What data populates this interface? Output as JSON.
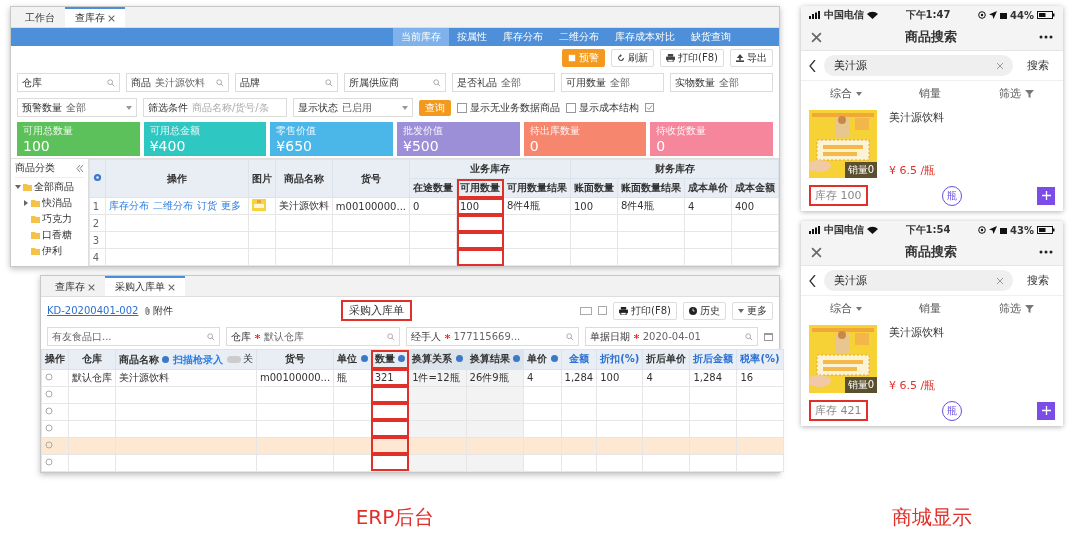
{
  "erp_inventory": {
    "tabs": [
      {
        "label": "工作台",
        "selected": false,
        "closable": false
      },
      {
        "label": "查库存",
        "selected": true,
        "closable": true
      }
    ],
    "nav_tabs": [
      {
        "label": "当前库存",
        "selected": true
      },
      {
        "label": "按属性",
        "selected": false
      },
      {
        "label": "库存分布",
        "selected": false
      },
      {
        "label": "二维分布",
        "selected": false
      },
      {
        "label": "库存成本对比",
        "selected": false
      },
      {
        "label": "缺货查询",
        "selected": false
      }
    ],
    "toolbar": [
      {
        "label": "预警",
        "kind": "warning"
      },
      {
        "label": "刷新",
        "kind": "refresh"
      },
      {
        "label": "打印(F8)",
        "kind": "print"
      },
      {
        "label": "导出",
        "kind": "export"
      }
    ],
    "filters_row_1": [
      {
        "label": "仓库",
        "kind": "search"
      },
      {
        "label": "商品",
        "value": "美汁源饮料",
        "kind": "search"
      },
      {
        "label": "品牌",
        "kind": "search"
      },
      {
        "label": "所属供应商",
        "kind": "search"
      },
      {
        "label": "是否礼品",
        "value": "全部",
        "kind": "select"
      },
      {
        "label": "可用数量",
        "value": "全部",
        "kind": "select"
      },
      {
        "label": "实物数量",
        "value": "全部",
        "kind": "select"
      }
    ],
    "filters_row_2": [
      {
        "label": "预警数量",
        "value": "全部",
        "kind": "select"
      },
      {
        "label": "筛选条件",
        "placeholder": "商品名称/货号/条",
        "kind": "text"
      },
      {
        "label": "显示状态",
        "value": "已启用",
        "kind": "select"
      }
    ],
    "query_button": "查询",
    "checkboxes": [
      {
        "label": "显示无业务数据商品",
        "checked": false
      },
      {
        "label": "显示成本结构",
        "checked": false
      }
    ],
    "summary_cards": [
      {
        "label": "可用总数量",
        "value": "100",
        "color": "#5cc15a"
      },
      {
        "label": "可用总金额",
        "value": "¥400",
        "color": "#2ec7c2"
      },
      {
        "label": "零售价值",
        "value": "¥650",
        "color": "#4bb6e8"
      },
      {
        "label": "批发价值",
        "value": "¥500",
        "color": "#9c8fd8"
      },
      {
        "label": "待出库数量",
        "value": "0",
        "color": "#f7866f"
      },
      {
        "label": "待收货数量",
        "value": "0",
        "color": "#f6869c"
      }
    ],
    "sidebar": {
      "title": "商品分类",
      "tree": [
        {
          "label": "全部商品",
          "expanded": true,
          "children": [
            {
              "label": "快消品",
              "expanded": false
            },
            {
              "label": "巧克力"
            },
            {
              "label": "口香糖"
            },
            {
              "label": "伊利"
            }
          ]
        }
      ]
    },
    "table": {
      "column_groups": [
        {
          "columns": [
            {
              "label": "操作"
            },
            {
              "label": "图片"
            },
            {
              "label": "商品名称"
            },
            {
              "label": "货号"
            }
          ]
        },
        {
          "label": "业务库存",
          "columns": [
            {
              "label": "在途数量"
            },
            {
              "label": "可用数量",
              "annotated": true
            },
            {
              "label": "可用数量结果"
            }
          ]
        },
        {
          "label": "财务库存",
          "columns": [
            {
              "label": "账面数量"
            },
            {
              "label": "账面数量结果"
            },
            {
              "label": "成本单价"
            },
            {
              "label": "成本金额"
            }
          ]
        }
      ],
      "rows": [
        {
          "index": "1",
          "actions": [
            "库存分布",
            "二维分布",
            "订货",
            "更多"
          ],
          "image": true,
          "cells": [
            "美汁源饮料",
            "m00100000...",
            "0",
            "100",
            "8件4瓶",
            "100",
            "8件4瓶",
            "4",
            "400"
          ]
        },
        {
          "index": "2"
        },
        {
          "index": "3"
        },
        {
          "index": "4"
        }
      ]
    }
  },
  "erp_purchase": {
    "tabs": [
      {
        "label": "查库存",
        "selected": false,
        "closable": true
      },
      {
        "label": "采购入库单",
        "selected": true,
        "closable": true
      }
    ],
    "doc_number": "KD-20200401-002",
    "attachment": "附件",
    "title": "采购入库单",
    "title_annotated": true,
    "toolbar": [
      {
        "label": "打印(F8)",
        "kind": "print"
      },
      {
        "label": "历史",
        "kind": "history"
      },
      {
        "label": "更多",
        "kind": "more"
      }
    ],
    "fields": [
      {
        "value": "有友食品口...",
        "required": false
      },
      {
        "label": "仓库",
        "value": "默认仓库",
        "required": true
      },
      {
        "label": "经手人",
        "value": "177115669...",
        "required": true
      },
      {
        "label": "单据日期",
        "value": "2020-04-01",
        "required": true
      }
    ],
    "columns": [
      {
        "label": "操作"
      },
      {
        "label": "仓库"
      },
      {
        "label": "商品名称",
        "info": true,
        "scan_toggle": {
          "label": "扫描枪录入",
          "state": "关",
          "on": false
        }
      },
      {
        "label": "货号"
      },
      {
        "label": "单位",
        "info": true
      },
      {
        "label": "数量",
        "info": true,
        "annotated": true
      },
      {
        "label": "换算关系",
        "info": true,
        "readonly": true
      },
      {
        "label": "换算结果",
        "info": true,
        "readonly": true
      },
      {
        "label": "单价",
        "info": true
      },
      {
        "label": "金额",
        "link": true
      },
      {
        "label": "折扣(%)",
        "link": true
      },
      {
        "label": "折后单价"
      },
      {
        "label": "折后金额",
        "link": true
      },
      {
        "label": "税率(%)",
        "link": true
      }
    ],
    "rows": [
      {
        "selected": false,
        "cells": [
          "默认仓库",
          "美汁源饮料",
          "m00100000...",
          "瓶",
          "321",
          "1件=12瓶",
          "26件9瓶",
          "4",
          "1,284",
          "100",
          "4",
          "1,284",
          "16"
        ]
      },
      {
        "selected": false
      },
      {
        "selected": false
      },
      {
        "selected": false
      },
      {
        "selected": true
      },
      {
        "selected": false
      }
    ]
  },
  "erp_caption": "ERP后台",
  "phones": [
    {
      "carrier": "中国电信",
      "time": "下午1:47",
      "battery": "44%",
      "title": "商品搜索",
      "search_value": "美汁源",
      "search_button": "搜索",
      "sort_tabs": [
        {
          "label": "综合",
          "kind": "caret"
        },
        {
          "label": "销量",
          "kind": "plain"
        },
        {
          "label": "筛选",
          "kind": "funnel"
        }
      ],
      "product": {
        "name": "美汁源饮料",
        "sales_badge": "销量0",
        "price": "¥ 6.5 /瓶",
        "stock": "库存 100",
        "stock_annotated": true,
        "unit": "瓶"
      }
    },
    {
      "carrier": "中国电信",
      "time": "下午1:54",
      "battery": "43%",
      "title": "商品搜索",
      "search_value": "美汁源",
      "search_button": "搜索",
      "sort_tabs": [
        {
          "label": "综合",
          "kind": "caret"
        },
        {
          "label": "销量",
          "kind": "plain"
        },
        {
          "label": "筛选",
          "kind": "funnel"
        }
      ],
      "product": {
        "name": "美汁源饮料",
        "sales_badge": "销量0",
        "price": "¥ 6.5 /瓶",
        "stock": "库存 421",
        "stock_annotated": true,
        "unit": "瓶"
      }
    }
  ],
  "mall_caption": "商城显示"
}
